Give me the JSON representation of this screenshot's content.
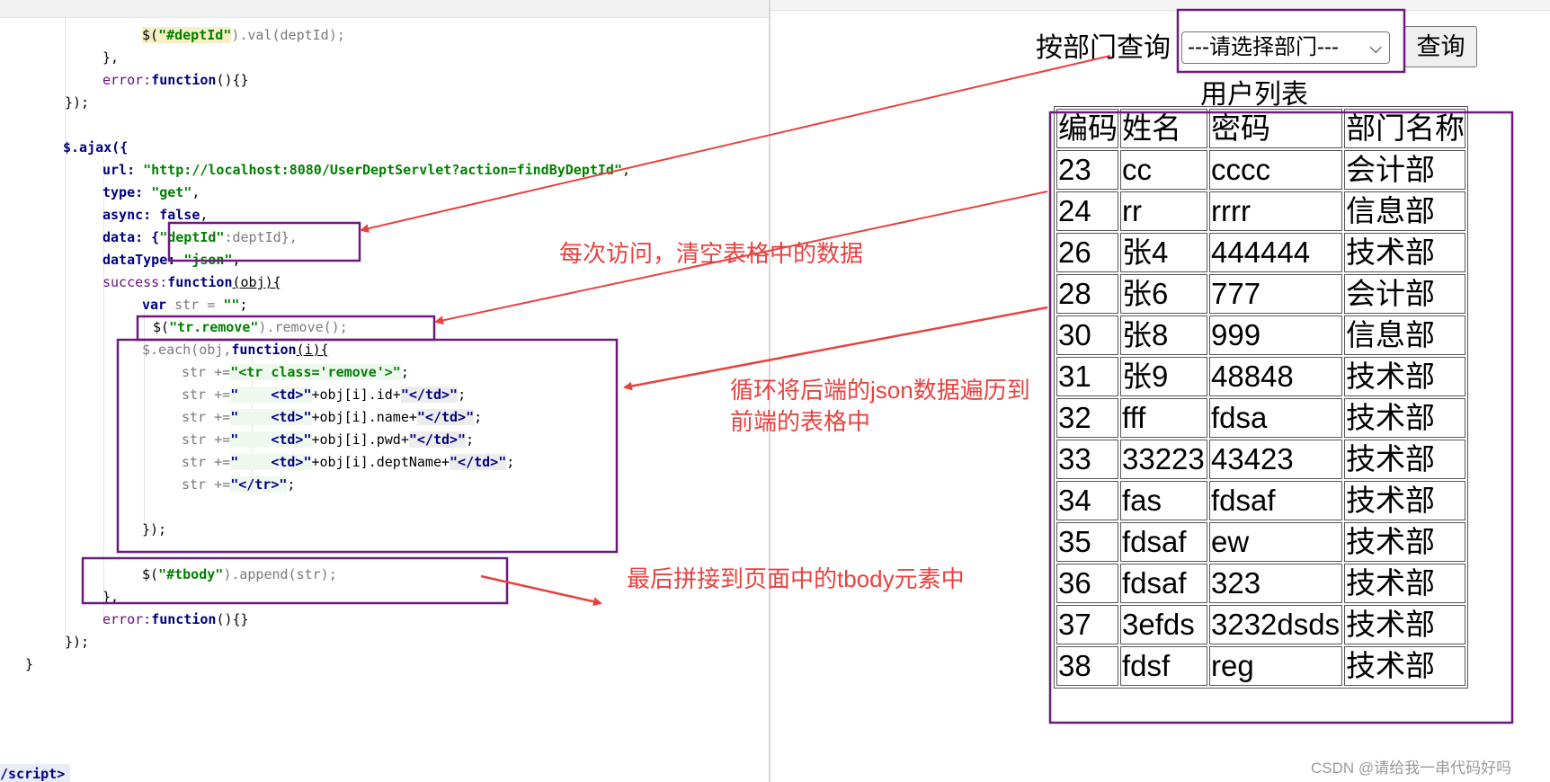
{
  "editor": {
    "lines": [
      [
        "$(",
        "\"#deptId\"",
        ").val(deptId);"
      ],
      [
        "},"
      ],
      [
        "error:",
        "function",
        "(){}"
      ],
      [
        "});"
      ],
      [
        ""
      ],
      [
        "$.ajax({"
      ],
      [
        "url: ",
        "\"http://localhost:8080/UserDeptServlet?action=findByDeptId\"",
        ","
      ],
      [
        "type: ",
        "\"get\"",
        ","
      ],
      [
        "async: ",
        "false",
        ","
      ],
      [
        "data: {",
        "\"deptId\"",
        ":deptId},"
      ],
      [
        "dataType: ",
        "\"json\"",
        ","
      ],
      [
        "success:",
        "function",
        "(obj){"
      ],
      [
        "var",
        " str = ",
        "\"\"",
        ";"
      ],
      [
        "$(",
        "\"tr.remove\"",
        ").remove();"
      ],
      [
        "$.each(obj,",
        "function",
        "(i){"
      ],
      [
        "str +=",
        "\"<tr class='remove'>\"",
        ";"
      ],
      [
        "str +=",
        "\"    <td>\"",
        "+obj[i].id+",
        "\"</td>\"",
        ";"
      ],
      [
        "str +=",
        "\"    <td>\"",
        "+obj[i].name+",
        "\"</td>\"",
        ";"
      ],
      [
        "str +=",
        "\"    <td>\"",
        "+obj[i].pwd+",
        "\"</td>\"",
        ";"
      ],
      [
        "str +=",
        "\"    <td>\"",
        "+obj[i].deptName+",
        "\"</td>\"",
        ";"
      ],
      [
        "str +=",
        "\"</tr>\"",
        ";"
      ],
      [
        ""
      ],
      [
        "});"
      ],
      [
        ""
      ],
      [
        "$(",
        "\"#tbody\"",
        ").append(str);"
      ],
      [
        "},"
      ],
      [
        "error:",
        "function",
        "(){}"
      ],
      [
        "});"
      ],
      [
        "}"
      ]
    ],
    "script_close": "/script>"
  },
  "browser": {
    "query_label": "按部门查询",
    "select_value": "---请选择部门---",
    "query_button": "查询",
    "list_title": "用户列表",
    "table": {
      "headers": [
        "编码",
        "姓名",
        "密码",
        "部门名称"
      ],
      "rows": [
        [
          "23",
          "cc",
          "cccc",
          "会计部"
        ],
        [
          "24",
          "rr",
          "rrrr",
          "信息部"
        ],
        [
          "26",
          "张4",
          "444444",
          "技术部"
        ],
        [
          "28",
          "张6",
          "777",
          "会计部"
        ],
        [
          "30",
          "张8",
          "999",
          "信息部"
        ],
        [
          "31",
          "张9",
          "48848",
          "技术部"
        ],
        [
          "32",
          "fff",
          "fdsa",
          "技术部"
        ],
        [
          "33",
          "33223",
          "43423",
          "技术部"
        ],
        [
          "34",
          "fas",
          "fdsaf",
          "技术部"
        ],
        [
          "35",
          "fdsaf",
          "ew",
          "技术部"
        ],
        [
          "36",
          "fdsaf",
          "323",
          "技术部"
        ],
        [
          "37",
          "3efds",
          "3232dsds",
          "技术部"
        ],
        [
          "38",
          "fdsf",
          "reg",
          "技术部"
        ]
      ]
    }
  },
  "annotations": {
    "clear_table": "每次访问，清空表格中的数据",
    "loop_line1": "循环将后端的json数据遍历到",
    "loop_line2": "前端的表格中",
    "append_tbody": "最后拼接到页面中的tbody元素中",
    "watermark": "CSDN @请给我一串代码好吗"
  },
  "colors": {
    "annotation_red": "#e8423f",
    "box_purple": "#6c1a7e",
    "keyword_blue": "#000080",
    "string_green": "#008000"
  }
}
